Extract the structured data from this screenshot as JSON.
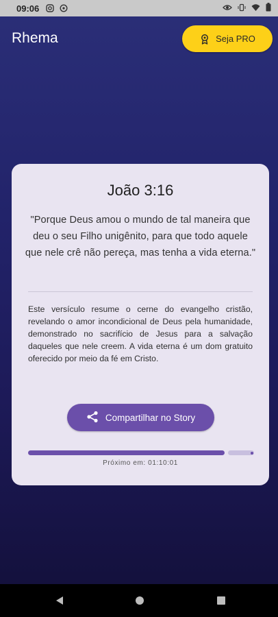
{
  "status_bar": {
    "time": "09:06",
    "left_icons": [
      "instagram-icon",
      "whatsapp-icon"
    ],
    "right_icons": [
      "eye-icon",
      "vibrate-icon",
      "wifi-icon",
      "battery-icon"
    ]
  },
  "header": {
    "app_title": "Rhema",
    "pro_button": {
      "label": "Seja PRO",
      "icon": "crown-badge-icon",
      "color": "#fdd018"
    }
  },
  "card": {
    "reference": "João 3:16",
    "verse": "\"Porque Deus amou o mundo de tal maneira que deu o seu Filho unigênito, para que todo aquele que nele crê não pereça, mas tenha a vida eterna.\"",
    "explanation": "Este versículo resume o cerne do evangelho cristão, revelando o amor incondicional de Deus pela humanidade, demonstrado no sacrifício de Jesus para a salvação daqueles que nele creem.  A vida eterna é um dom gratuito oferecido por meio da fé em Cristo.",
    "share_button": {
      "label": "Compartilhar no Story",
      "icon": "share-icon",
      "color": "#6b4faa"
    },
    "progress": {
      "fraction": 0.87
    },
    "countdown": "Próximo em: 01:10:01"
  },
  "nav_bar": {
    "buttons": [
      "back-icon",
      "home-icon",
      "recents-icon"
    ]
  }
}
